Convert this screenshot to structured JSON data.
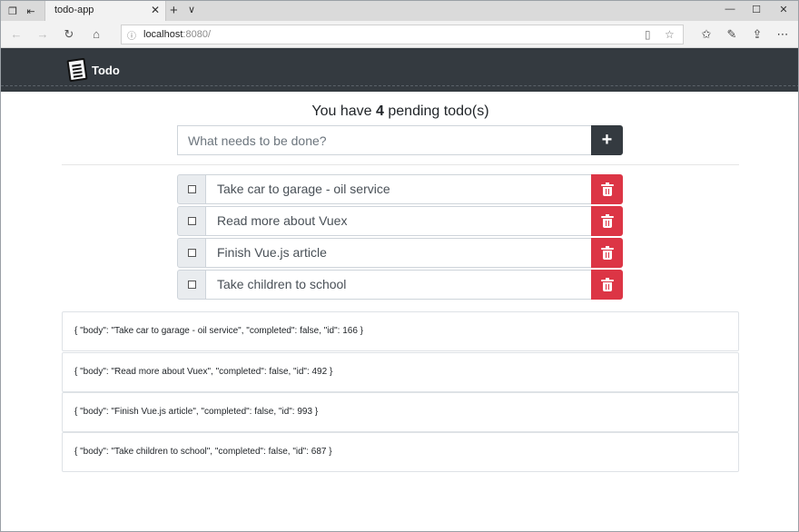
{
  "browser": {
    "tab_title": "todo-app",
    "tab_close": "✕",
    "new_tab": "+",
    "tab_menu": "∨",
    "url_host": "localhost",
    "url_port": ":8080/",
    "minimize": "—",
    "maximize": "☐",
    "close": "✕"
  },
  "app": {
    "brand": "Todo",
    "pending_prefix": "You have ",
    "pending_count": "4",
    "pending_suffix": " pending todo(s)",
    "new_todo_placeholder": "What needs to be done?",
    "add_label": "+"
  },
  "todos": [
    {
      "body": "Take car to garage - oil service",
      "completed": false
    },
    {
      "body": "Read more about Vuex",
      "completed": false
    },
    {
      "body": "Finish Vue.js article",
      "completed": false
    },
    {
      "body": "Take children to school",
      "completed": false
    }
  ],
  "json_dump": [
    "{ \"body\": \"Take car to garage - oil service\", \"completed\": false, \"id\": 166 }",
    "{ \"body\": \"Read more about Vuex\", \"completed\": false, \"id\": 492 }",
    "{ \"body\": \"Finish Vue.js article\", \"completed\": false, \"id\": 993 }",
    "{ \"body\": \"Take children to school\", \"completed\": false, \"id\": 687 }"
  ]
}
